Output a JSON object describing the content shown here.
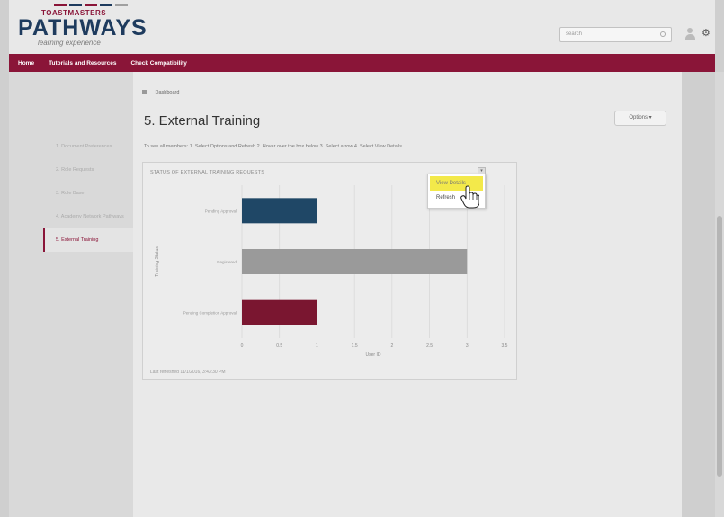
{
  "header": {
    "brand_top": "TOASTMASTERS",
    "brand": "PATHWAYS",
    "brand_sub": "learning experience",
    "search_placeholder": "search",
    "stripe_colors": [
      "#8a1538",
      "#1e3b5e",
      "#8a1538",
      "#1e3b5e",
      "#a0a0a0"
    ]
  },
  "nav": {
    "items": [
      "Home",
      "Tutorials and Resources",
      "Check Compatibility"
    ]
  },
  "sidebar": {
    "items": [
      {
        "label": "1. Document Preferences"
      },
      {
        "label": "2. Role Requests"
      },
      {
        "label": "3. Role Base"
      },
      {
        "label": "4. Academy Network Pathways"
      },
      {
        "label": "5. External Training",
        "active": true
      }
    ]
  },
  "breadcrumb": {
    "label": "Dashboard"
  },
  "page": {
    "title": "5. External Training",
    "options_label": "Options ▾",
    "instructions": "To see all members: 1. Select Options and Refresh 2. Hover over the box below 3. Select arrow 4. Select View Details"
  },
  "panel": {
    "title": "STATUS OF EXTERNAL TRAINING REQUESTS",
    "menu_icon": "▾",
    "menu_items": [
      "View Details",
      "Refresh"
    ],
    "last_refreshed": "Last refreshed 11/1/2016, 3:43:30 PM"
  },
  "chart_data": {
    "type": "bar",
    "orientation": "horizontal",
    "categories": [
      "Pending Approval",
      "Registered",
      "Pending Completion Approval"
    ],
    "values": [
      1,
      3,
      1
    ],
    "bar_colors": [
      "#1f4766",
      "#9a9a9a",
      "#7a1630"
    ],
    "xlabel": "User ID",
    "ylabel": "Training Status",
    "xlim": [
      0,
      3.5
    ],
    "x_ticks": [
      "0",
      "0.5",
      "1",
      "1.5",
      "2",
      "2.5",
      "3",
      "3.5"
    ],
    "grid": true
  },
  "colors": {
    "accent": "#8a1538",
    "brand_blue": "#1e3b5e",
    "highlight": "#f3e94a"
  }
}
